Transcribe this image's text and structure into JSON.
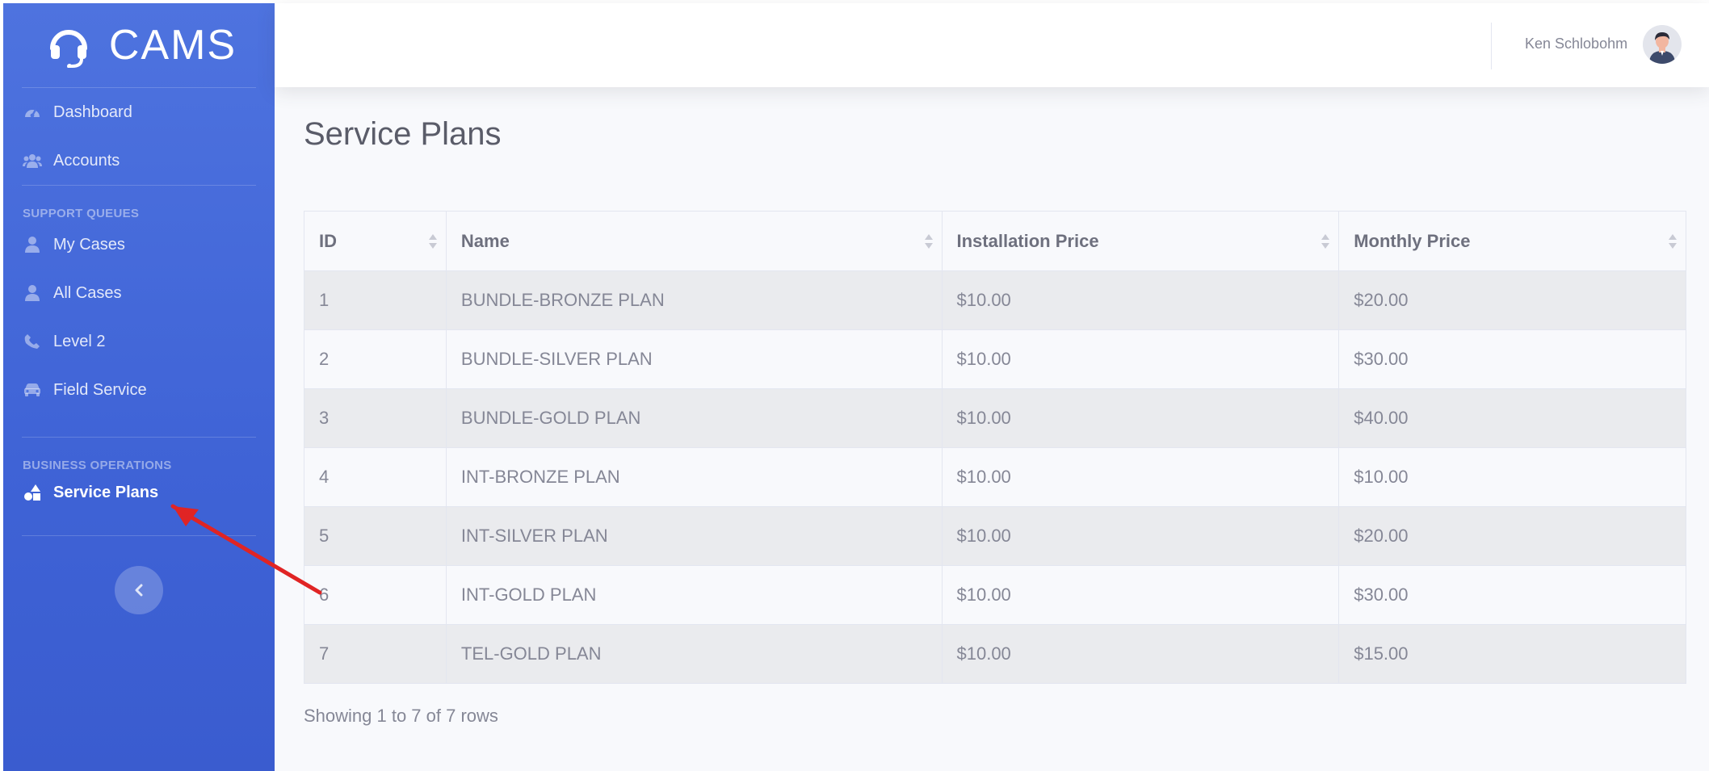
{
  "brand": {
    "name": "CAMS",
    "icon": "headset-icon"
  },
  "sidebar": {
    "items_top": [
      {
        "label": "Dashboard",
        "icon": "tachometer-icon"
      },
      {
        "label": "Accounts",
        "icon": "users-icon"
      }
    ],
    "support_heading": "SUPPORT QUEUES",
    "support_items": [
      {
        "label": "My Cases",
        "icon": "user-icon"
      },
      {
        "label": "All Cases",
        "icon": "user-icon"
      },
      {
        "label": "Level 2",
        "icon": "phone-icon"
      },
      {
        "label": "Field Service",
        "icon": "car-icon"
      }
    ],
    "business_heading": "BUSINESS OPERATIONS",
    "business_items": [
      {
        "label": "Service Plans",
        "icon": "shapes-icon",
        "active": true
      }
    ],
    "toggle_icon": "chevron-left-icon"
  },
  "topbar": {
    "user_name": "Ken Schlobohm",
    "avatar_icon": "avatar-icon"
  },
  "page": {
    "title": "Service Plans"
  },
  "table": {
    "columns": [
      "ID",
      "Name",
      "Installation Price",
      "Monthly Price"
    ],
    "rows": [
      [
        "1",
        "BUNDLE-BRONZE PLAN",
        "$10.00",
        "$20.00"
      ],
      [
        "2",
        "BUNDLE-SILVER PLAN",
        "$10.00",
        "$30.00"
      ],
      [
        "3",
        "BUNDLE-GOLD PLAN",
        "$10.00",
        "$40.00"
      ],
      [
        "4",
        "INT-BRONZE PLAN",
        "$10.00",
        "$10.00"
      ],
      [
        "5",
        "INT-SILVER PLAN",
        "$10.00",
        "$20.00"
      ],
      [
        "6",
        "INT-GOLD PLAN",
        "$10.00",
        "$30.00"
      ],
      [
        "7",
        "TEL-GOLD PLAN",
        "$10.00",
        "$15.00"
      ]
    ],
    "footer": "Showing 1 to 7 of 7 rows"
  },
  "colors": {
    "sidebar": "#4e73df",
    "annotation_arrow": "#e02424"
  }
}
